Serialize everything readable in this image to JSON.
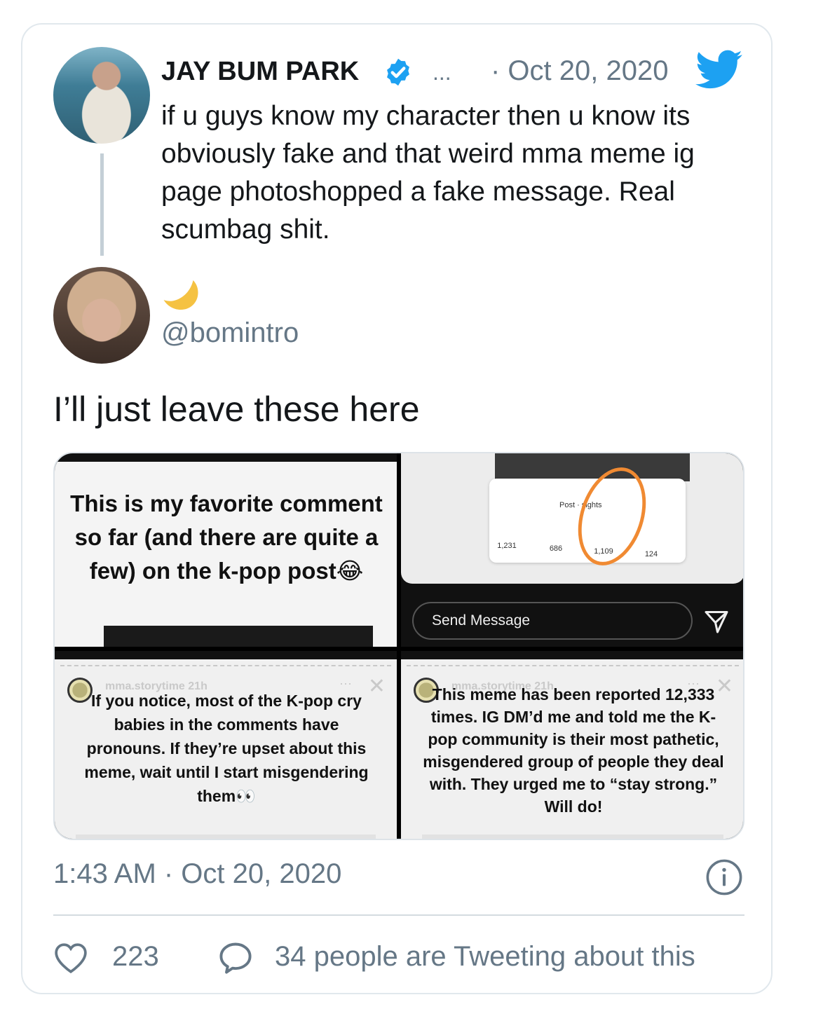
{
  "colors": {
    "text_primary": "#14171a",
    "text_secondary": "#657786",
    "twitter_blue": "#1da1f2",
    "border": "#e1e8ed",
    "highlight_circle": "#f08a32"
  },
  "quoted_tweet": {
    "author_name": "JAY BUM PARK",
    "verified_icon": "verified-badge-icon",
    "more_label": "...",
    "date": "· Oct 20, 2020",
    "text": "if u guys know my character then u know its obviously fake and that weird mma meme ig page photoshopped a fake message.  Real scumbag shit."
  },
  "reply_tweet": {
    "display_name_icon": "crescent-moon-emoji",
    "handle": "@bomintro",
    "text": "I’ll just leave these here"
  },
  "media": {
    "panel1": {
      "caption": "This is my favorite comment so far (and there are quite a few) on the k-pop post😂"
    },
    "panel2": {
      "sheet_title": "Post · sights",
      "stats": [
        "1,231",
        "686",
        "1,109",
        "124"
      ],
      "send_placeholder": "Send Message"
    },
    "panel3": {
      "user": "mma.storytime  21h",
      "more": "···",
      "text": "If you notice, most of the K-pop cry babies in the comments have pronouns. If they’re upset about this meme, wait until I start misgendering them👀"
    },
    "panel4": {
      "user": "mma.storytime  21h",
      "more": "···",
      "text": "This meme has been reported 12,333 times. IG DM’d me and told me the K-pop community is their most pathetic, misgendered group of people they deal with. They urged me to “stay strong.” Will do!"
    }
  },
  "footer": {
    "timestamp": "1:43 AM · Oct 20, 2020",
    "like_count": "223",
    "tweeting_about": "34 people are Tweeting about this"
  }
}
